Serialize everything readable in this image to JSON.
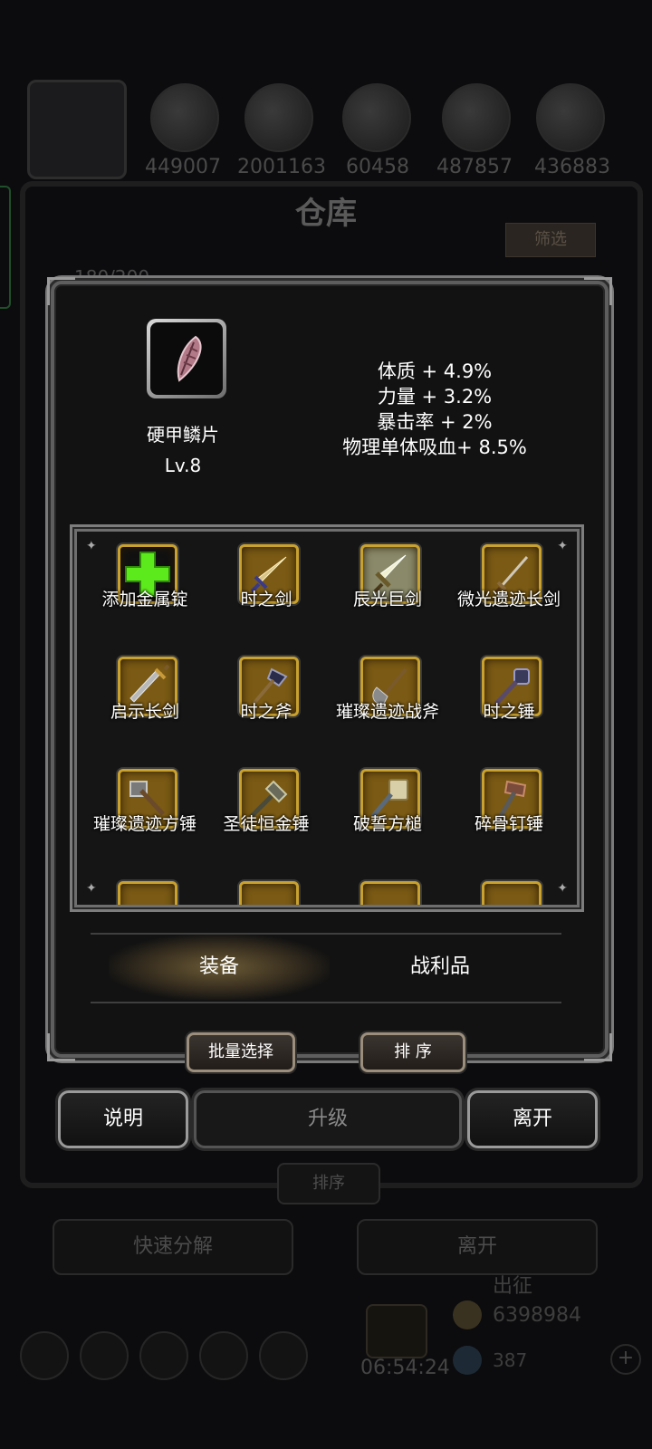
{
  "background": {
    "resource_values": [
      "449007",
      "2001163",
      "60458",
      "487857",
      "436883"
    ],
    "title": "仓库",
    "filter_label": "筛选",
    "capacity": "180/200",
    "sort_label": "排序",
    "decompose_label": "快速分解",
    "leave_label": "离开",
    "sortie_label": "出征",
    "coins": "6398984",
    "gems": "387",
    "timer": "06:54:24"
  },
  "item": {
    "name": "硬甲鳞片",
    "level": "Lv.8",
    "icon": "feather-scale-icon"
  },
  "stats": [
    "体质 + 4.9%",
    "力量 + 3.2%",
    "暴击率 + 2%",
    "物理单体吸血+ 8.5%"
  ],
  "grid_items": [
    {
      "label": "添加金属锭",
      "icon": "green-plus-icon"
    },
    {
      "label": "时之剑",
      "icon": "sword-icon"
    },
    {
      "label": "辰光巨剑",
      "icon": "greatsword-icon"
    },
    {
      "label": "微光遗迹长剑",
      "icon": "longsword-icon"
    },
    {
      "label": "启示长剑",
      "icon": "broadsword-icon"
    },
    {
      "label": "时之斧",
      "icon": "axe-icon"
    },
    {
      "label": "璀璨遗迹战斧",
      "icon": "battleaxe-icon"
    },
    {
      "label": "时之锤",
      "icon": "mace-icon"
    },
    {
      "label": "璀璨遗迹方锤",
      "icon": "square-hammer-icon"
    },
    {
      "label": "圣徒恒金锤",
      "icon": "warhammer-icon"
    },
    {
      "label": "破誓方槌",
      "icon": "mallet-icon"
    },
    {
      "label": "碎骨钉锤",
      "icon": "spiked-hammer-icon"
    }
  ],
  "tabs": {
    "equipment": "装备",
    "loot": "战利品"
  },
  "buttons": {
    "batch_select": "批量选择",
    "sort": "排 序",
    "info": "说明",
    "upgrade": "升级",
    "leave": "离开"
  },
  "colors": {
    "slot_gold": "#c9a12e",
    "plus_green": "#5dea1c"
  }
}
